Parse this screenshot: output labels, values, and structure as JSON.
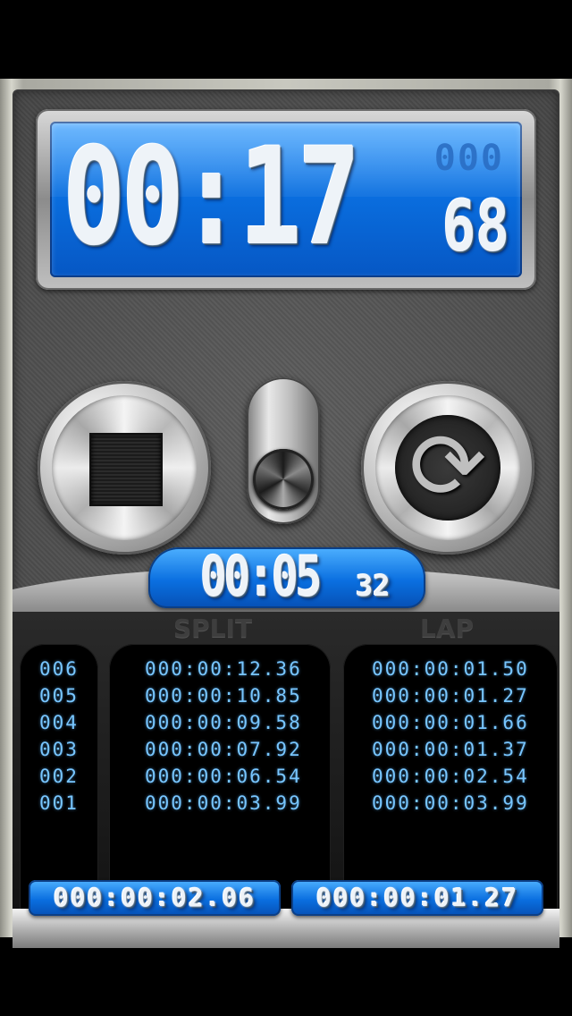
{
  "main_display": {
    "time": "00:17",
    "milliseconds_ghost": "000",
    "centiseconds": "68"
  },
  "split_display": {
    "time": "00:05",
    "centiseconds": "32"
  },
  "columns": {
    "split_header": "SPLIT",
    "lap_header": "LAP"
  },
  "rows": [
    {
      "num": "006",
      "split": "000:00:12.36",
      "lap": "000:00:01.50"
    },
    {
      "num": "005",
      "split": "000:00:10.85",
      "lap": "000:00:01.27"
    },
    {
      "num": "004",
      "split": "000:00:09.58",
      "lap": "000:00:01.66"
    },
    {
      "num": "003",
      "split": "000:00:07.92",
      "lap": "000:00:01.37"
    },
    {
      "num": "002",
      "split": "000:00:06.54",
      "lap": "000:00:02.54"
    },
    {
      "num": "001",
      "split": "000:00:03.99",
      "lap": "000:00:03.99"
    }
  ],
  "footer": {
    "left": "000:00:02.06",
    "right": "000:00:01.27"
  },
  "icons": {
    "stop": "stop-icon",
    "reset": "reset-icon",
    "toggle": "toggle-switch"
  },
  "colors": {
    "lcd_blue": "#0a6fe0",
    "list_text": "#78c6ff"
  }
}
